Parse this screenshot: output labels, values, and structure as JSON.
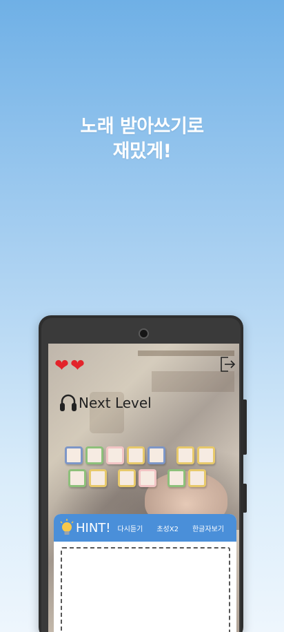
{
  "headline": {
    "line1": "노래 받아쓰기로",
    "line2": "재밌게!"
  },
  "game": {
    "lives": 2,
    "heart_icon": "heart-icon",
    "exit_icon": "exit-icon",
    "song_icon": "headphones-icon",
    "song_title": "Next Level",
    "tile_rows": [
      [
        "blue",
        "green",
        "pink",
        "yellow",
        "blue",
        "gap",
        "yellow",
        "yellow"
      ],
      [
        "green",
        "yellow",
        "gap",
        "yellow",
        "pink",
        "gap",
        "green",
        "yellow"
      ]
    ],
    "hint": {
      "icon": "lightbulb-icon",
      "label": "HINT!",
      "buttons": [
        "다시듣기",
        "초성X2",
        "한글자보기"
      ]
    }
  },
  "colors": {
    "heart": "#e3242b",
    "hint_bar": "#4a8fd9",
    "tile_blue": "#7d96c7",
    "tile_green": "#8dc07a",
    "tile_pink": "#f2c4c4",
    "tile_yellow": "#e7c96b"
  }
}
